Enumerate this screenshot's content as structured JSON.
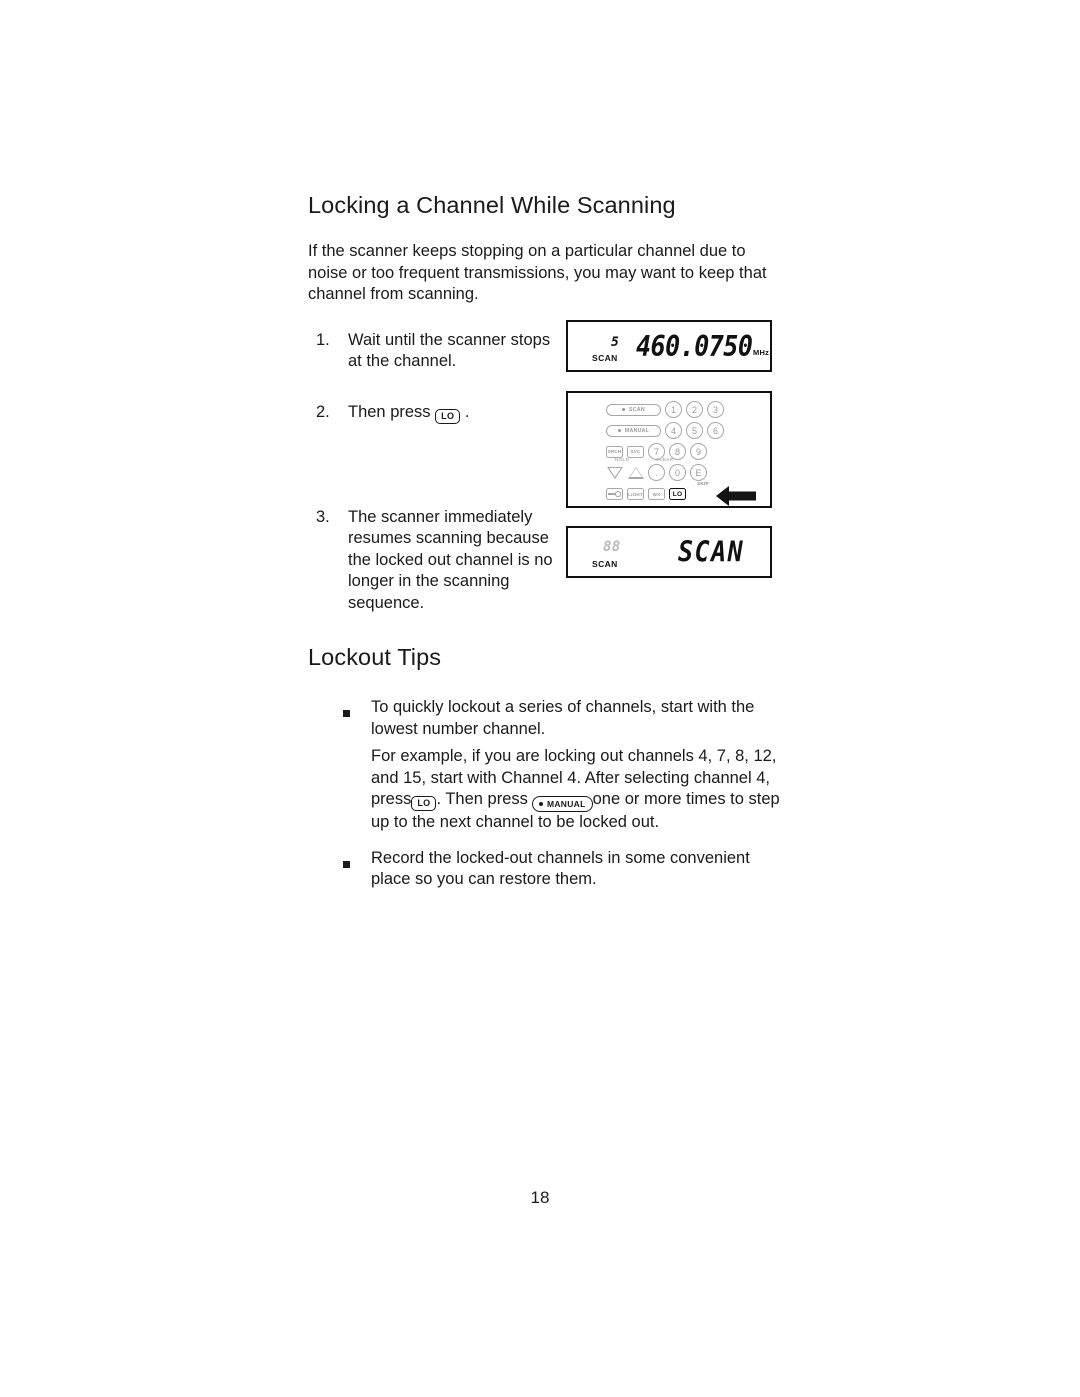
{
  "page": {
    "number": "18"
  },
  "section1": {
    "title": "Locking a Channel While Scanning",
    "intro": "If the scanner keeps stopping on a particular channel due to noise or too frequent transmissions, you may want to keep that channel from scanning.",
    "steps": [
      {
        "number": "1.",
        "text": "Wait until the scanner stops at the channel."
      },
      {
        "number": "2.",
        "text_before": "Then press",
        "key": "LO",
        "text_after": "."
      },
      {
        "number": "3.",
        "text": "The scanner immediately resumes scanning because the locked out channel is no longer in the scanning sequence."
      }
    ]
  },
  "figures": {
    "lcd_step1": {
      "channel": "5",
      "frequency": "460.0750",
      "unit": "MHz",
      "indicator": "SCAN"
    },
    "lcd_step3": {
      "channel": "88",
      "mode": "SCAN",
      "indicator": "SCAN"
    },
    "keypad": {
      "row1": [
        "SCAN",
        "1",
        "2",
        "3"
      ],
      "row2": [
        "MANUAL",
        "4",
        "5",
        "6"
      ],
      "row3": [
        "SRCH",
        "SVC",
        "7",
        "8",
        "9"
      ],
      "row4": [
        ".",
        "0",
        "E"
      ],
      "row5": [
        "LIGHT",
        "WX",
        "LO"
      ],
      "micro_labels": {
        "hold": "HOLD",
        "clear": "CLEAR",
        "skip": "SKIP"
      },
      "highlight_key": "LO",
      "pointer": "left-arrow-pointer"
    }
  },
  "section2": {
    "title": "Lockout Tips",
    "tips": [
      {
        "text": "To quickly lockout a series of channels, start with the lowest number channel.",
        "sub": {
          "part1": "For example, if you are locking out channels 4, 7, 8, 12, and 15, start with Channel 4. After selecting channel 4, press",
          "key1": "LO",
          "part2": ". Then press",
          "key2": "MANUAL",
          "part3": "one or more times to step up to the next channel to be locked out."
        }
      },
      {
        "text": "Record the locked-out channels in some convenient place so you can restore them."
      }
    ]
  }
}
